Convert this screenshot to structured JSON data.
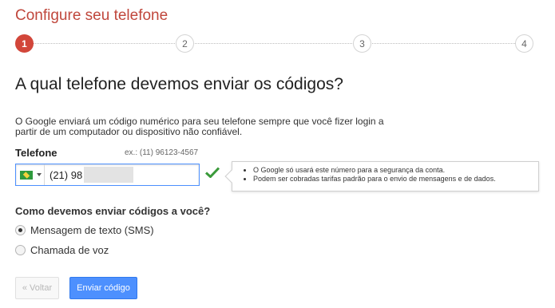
{
  "header": {
    "title": "Configure seu telefone"
  },
  "stepper": {
    "steps": [
      "1",
      "2",
      "3",
      "4"
    ],
    "current": 1
  },
  "main": {
    "question": "A qual telefone devemos enviar os códigos?",
    "info": "O Google enviará um código numérico para seu telefone sempre que você fizer login a partir de um computador ou dispositivo não confiável."
  },
  "phone": {
    "label": "Telefone",
    "example": "ex.: (11) 96123-4567",
    "country_icon": "brazil-flag-icon",
    "value": "(21) 98",
    "valid_icon": "checkmark-icon",
    "valid_color": "#3a9a3a"
  },
  "tip": {
    "items": [
      "O Google só usará este número para a segurança da conta.",
      "Podem ser cobradas tarifas padrão para o envio de mensagens e de dados."
    ]
  },
  "delivery": {
    "question": "Como devemos enviar códigos a você?",
    "options": [
      {
        "label": "Mensagem de texto (SMS)",
        "selected": true
      },
      {
        "label": "Chamada de voz",
        "selected": false
      }
    ]
  },
  "buttons": {
    "back": "« Voltar",
    "send": "Enviar código"
  },
  "colors": {
    "title": "#c0473c",
    "active_step": "#d2463a",
    "primary_button": "#4d90fe"
  }
}
